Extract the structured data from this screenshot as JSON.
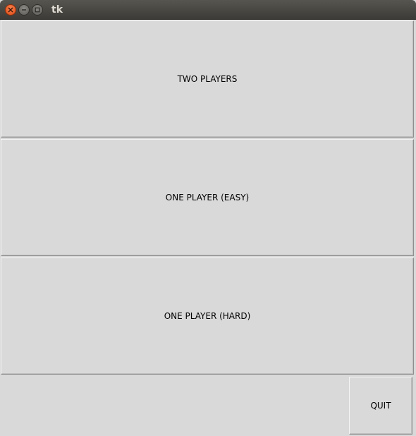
{
  "window": {
    "title": "tk",
    "controls": {
      "close": "close-icon",
      "minimize": "minimize-icon",
      "maximize": "maximize-icon"
    }
  },
  "menu": {
    "two_players_label": "TWO PLAYERS",
    "one_player_easy_label": "ONE PLAYER (EASY)",
    "one_player_hard_label": "ONE PLAYER (HARD)",
    "quit_label": "QUIT"
  },
  "colors": {
    "window_background": "#d9d9d9",
    "titlebar": "#3c3b37",
    "close_button": "#df4b16",
    "text": "#000000"
  }
}
